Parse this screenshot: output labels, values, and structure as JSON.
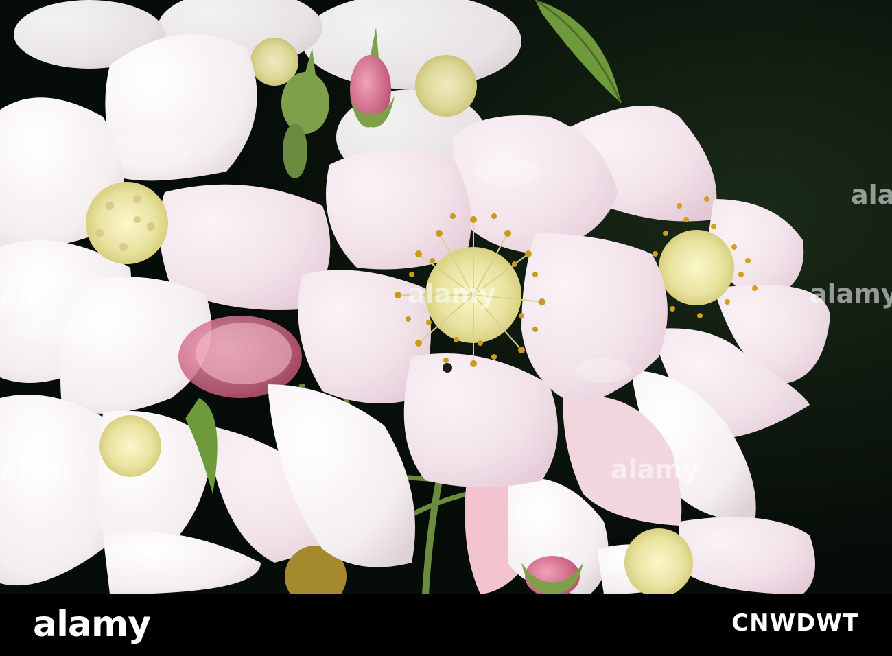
{
  "watermark": {
    "text": "alamy"
  },
  "footer": {
    "logo": "alamy",
    "image_id": "CNWDWT"
  },
  "colors": {
    "background": "#0c1a10",
    "petal": "#f7eef2",
    "petal_shadow": "#e6d3dc",
    "bud": "#d86a8a",
    "stamen": "#c99a1f",
    "stem": "#6b8c3f",
    "footer": "#000000"
  }
}
